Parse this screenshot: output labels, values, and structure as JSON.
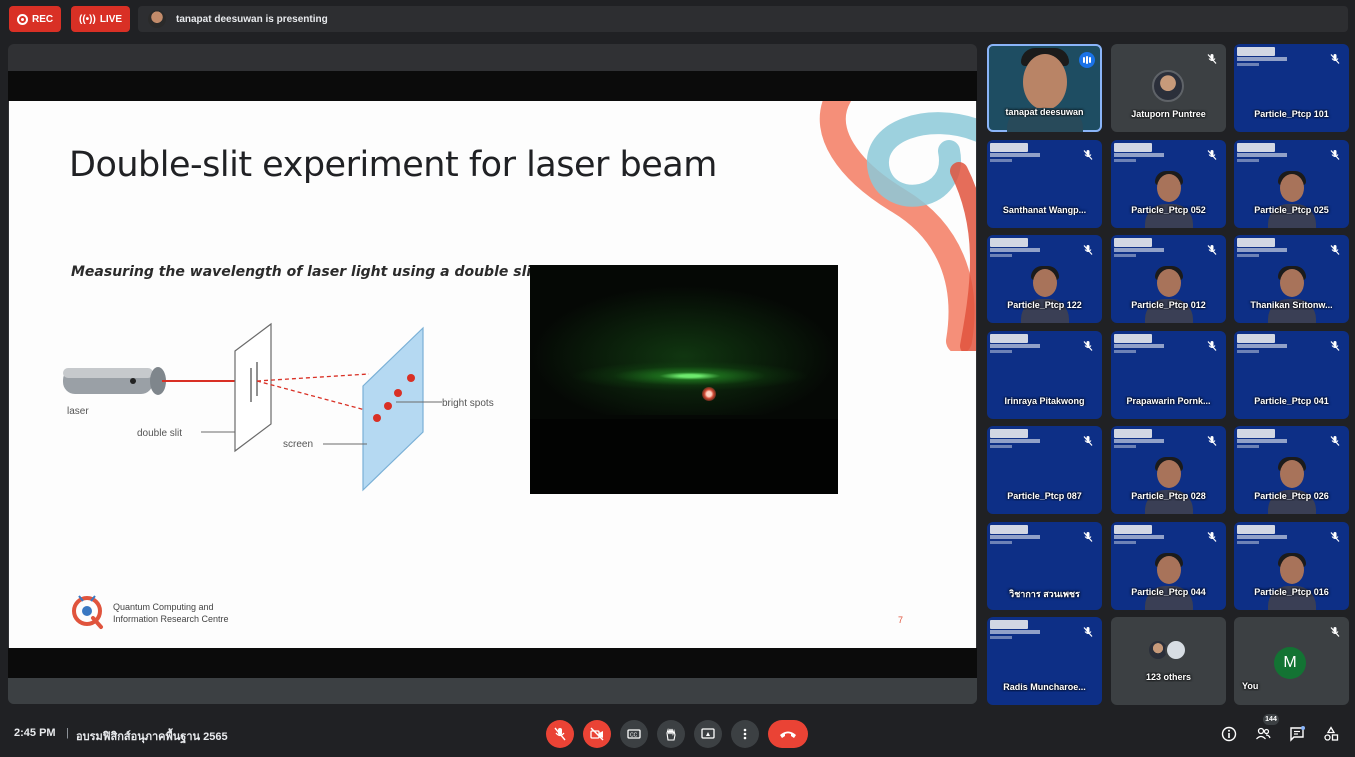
{
  "topbar": {
    "rec_label": "REC",
    "live_label": "LIVE",
    "presenting_text": "tanapat deesuwan is presenting"
  },
  "slide": {
    "title": "Double-slit experiment for laser beam",
    "subtitle": "Measuring the wavelength of laser light using a double slit",
    "diagram_labels": {
      "laser": "laser",
      "double_slit": "double slit",
      "screen": "screen",
      "bright_spots": "bright spots"
    },
    "logo_line1": "Quantum Computing and",
    "logo_line2": "Information Research Centre",
    "page_number": "7",
    "accent_colors": [
      "#f4836a",
      "#8cc9d8",
      "#e0543d"
    ]
  },
  "participants": [
    {
      "name": "tanapat deesuwan",
      "speaking": true
    },
    {
      "name": "Jatuporn Puntree"
    },
    {
      "name": "Particle_Ptcp 101"
    },
    {
      "name": "Santhanat Wangp..."
    },
    {
      "name": "Particle_Ptcp 052"
    },
    {
      "name": "Particle_Ptcp 025"
    },
    {
      "name": "Particle_Ptcp 122"
    },
    {
      "name": "Particle_Ptcp 012"
    },
    {
      "name": "Thanikan Sritonw..."
    },
    {
      "name": "Irinraya Pitakwong"
    },
    {
      "name": "Prapawarin Pornk..."
    },
    {
      "name": "Particle_Ptcp 041"
    },
    {
      "name": "Particle_Ptcp 087"
    },
    {
      "name": "Particle_Ptcp 028"
    },
    {
      "name": "Particle_Ptcp 026"
    },
    {
      "name": "วิชาการ สวนเพชร"
    },
    {
      "name": "Particle_Ptcp 044"
    },
    {
      "name": "Particle_Ptcp 016"
    },
    {
      "name": "Radis Muncharoe..."
    },
    {
      "name": "123 others"
    },
    {
      "name": "You",
      "avatar_letter": "M"
    }
  ],
  "bottombar": {
    "time": "2:45 PM",
    "separator": "|",
    "meeting_title": "อบรมฟิสิกส์อนุภาคพื้นฐาน 2565",
    "participants_count": "144"
  },
  "icons": {
    "controls": [
      "mic-off-icon",
      "camera-off-icon",
      "captions-icon",
      "raise-hand-icon",
      "present-icon",
      "more-options-icon",
      "hangup-icon"
    ],
    "right": [
      "info-icon",
      "people-icon",
      "chat-icon",
      "activities-icon"
    ]
  }
}
